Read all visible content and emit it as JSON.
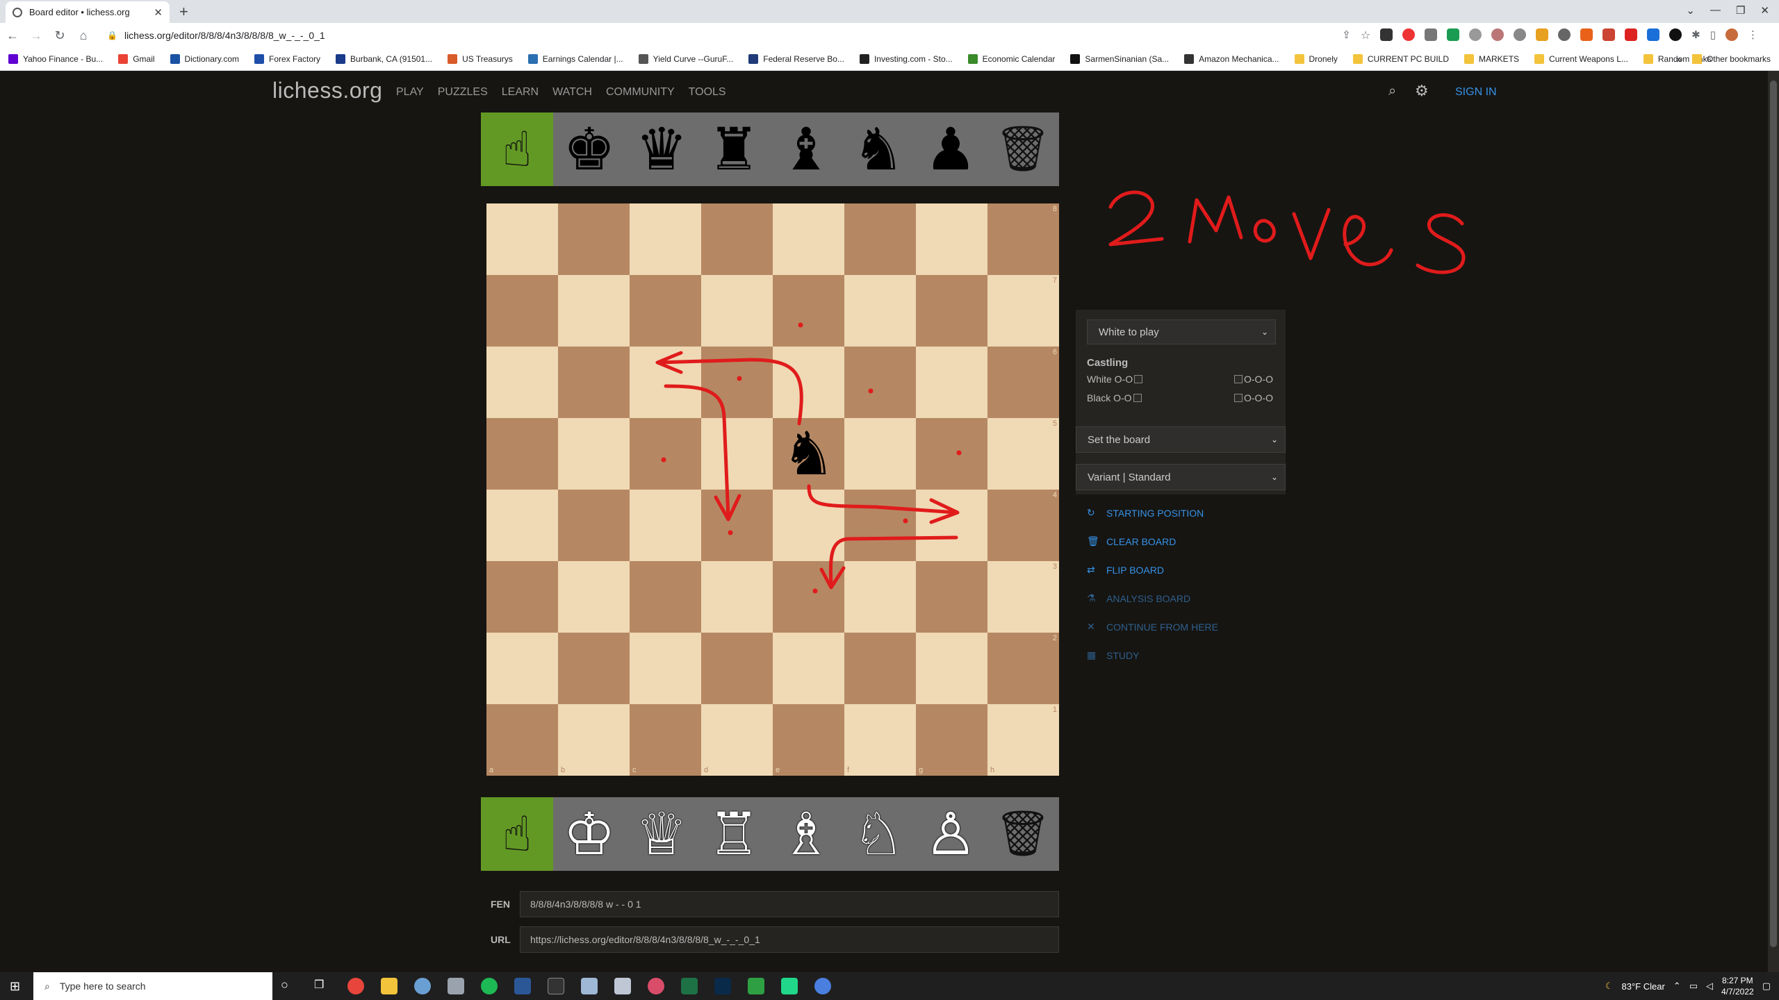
{
  "browser": {
    "tab_title": "Board editor • lichess.org",
    "url": "lichess.org/editor/8/8/8/4n3/8/8/8/8_w_-_-_0_1",
    "bookmarks": [
      "Yahoo Finance - Bu...",
      "Gmail",
      "Dictionary.com",
      "Forex Factory",
      "Burbank, CA (91501...",
      "US Treasurys",
      "Earnings Calendar |...",
      "Yield Curve --GuruF...",
      "Federal Reserve Bo...",
      "Investing.com - Sto...",
      "Economic Calendar",
      "SarmenSinanian (Sa...",
      "Amazon Mechanica...",
      "Dronely",
      "CURRENT PC BUILD",
      "MARKETS",
      "Current Weapons L...",
      "Random Links"
    ],
    "other_bookmarks": "Other bookmarks"
  },
  "site": {
    "logo": "lichess.org",
    "nav": [
      "PLAY",
      "PUZZLES",
      "LEARN",
      "WATCH",
      "COMMUNITY",
      "TOOLS"
    ],
    "sign_in": "SIGN IN"
  },
  "board": {
    "files": [
      "a",
      "b",
      "c",
      "d",
      "e",
      "f",
      "g",
      "h"
    ],
    "ranks": [
      "8",
      "7",
      "6",
      "5",
      "4",
      "3",
      "2",
      "1"
    ],
    "pieces": [
      {
        "square": "e5",
        "glyph": "♞",
        "name": "black-knight"
      }
    ]
  },
  "palettes": {
    "black": [
      "☝",
      "♚",
      "♛",
      "♜",
      "♝",
      "♞",
      "♟",
      "🗑"
    ],
    "white": [
      "☝",
      "♔",
      "♕",
      "♖",
      "♗",
      "♘",
      "♙",
      "🗑"
    ]
  },
  "annotation": {
    "text": "2 Moves",
    "color": "#e01b1b"
  },
  "panel": {
    "turn_select": "White to play",
    "castling_title": "Castling",
    "white_oo": "White O-O",
    "black_oo": "Black O-O",
    "ooo": "O-O-O",
    "set_board_select": "Set the board",
    "variant_select": "Variant | Standard",
    "actions": [
      {
        "label": "STARTING POSITION",
        "icon": "↻",
        "dim": false
      },
      {
        "label": "CLEAR BOARD",
        "icon": "🗑",
        "dim": false
      },
      {
        "label": "FLIP BOARD",
        "icon": "⇄",
        "dim": false
      },
      {
        "label": "ANALYSIS BOARD",
        "icon": "⚗",
        "dim": true
      },
      {
        "label": "CONTINUE FROM HERE",
        "icon": "✕",
        "dim": true
      },
      {
        "label": "STUDY",
        "icon": "▦",
        "dim": true
      }
    ]
  },
  "fen": {
    "label": "FEN",
    "value": "8/8/8/4n3/8/8/8/8 w - - 0 1"
  },
  "url_field": {
    "label": "URL",
    "value": "https://lichess.org/editor/8/8/8/4n3/8/8/8/8_w_-_-_0_1"
  },
  "taskbar": {
    "search_placeholder": "Type here to search",
    "weather": "83°F  Clear",
    "time": "8:27 PM",
    "date": "4/7/2022"
  },
  "colors": {
    "bg": "#161512",
    "board_light": "#f0d9b5",
    "board_dark": "#b58863",
    "accent": "#3692e7",
    "selected": "#629924"
  }
}
